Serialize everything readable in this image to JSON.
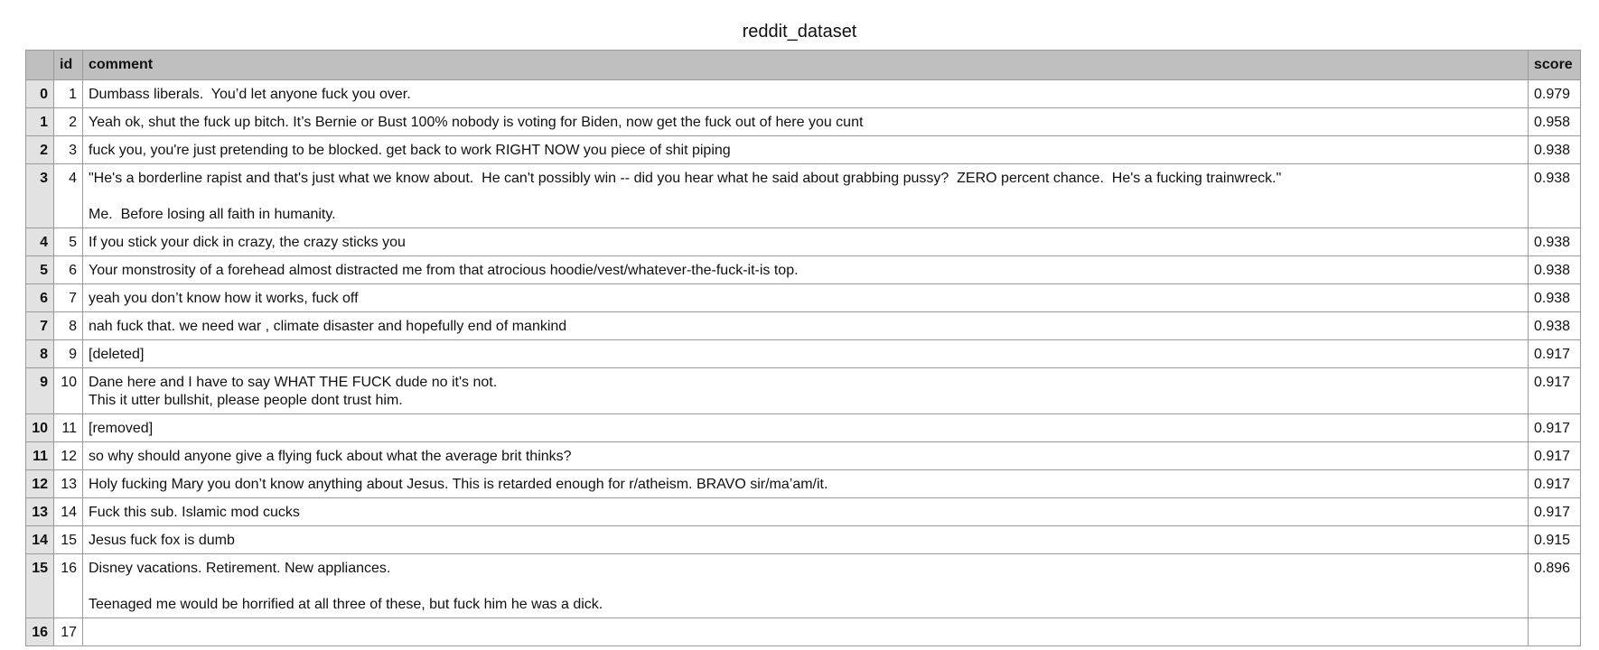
{
  "title": "reddit_dataset",
  "columns": {
    "index": "",
    "id": "id",
    "comment": "comment",
    "score": "score"
  },
  "rows": [
    {
      "index": "0",
      "id": "1",
      "comment": "Dumbass liberals.  You’d let anyone fuck you over.",
      "score": "0.979"
    },
    {
      "index": "1",
      "id": "2",
      "comment": "Yeah ok, shut the fuck up bitch. It’s Bernie or Bust 100% nobody is voting for Biden, now get the fuck out of here you cunt",
      "score": "0.958"
    },
    {
      "index": "2",
      "id": "3",
      "comment": "fuck you, you're just pretending to be blocked. get back to work RIGHT NOW you piece of shit piping",
      "score": "0.938"
    },
    {
      "index": "3",
      "id": "4",
      "comment": "\"He's a borderline rapist and that's just what we know about.  He can't possibly win -- did you hear what he said about grabbing pussy?  ZERO percent chance.  He's a fucking trainwreck.\"\n\nMe.  Before losing all faith in humanity.",
      "score": "0.938"
    },
    {
      "index": "4",
      "id": "5",
      "comment": "If you stick your dick in crazy, the crazy sticks you",
      "score": "0.938"
    },
    {
      "index": "5",
      "id": "6",
      "comment": "Your monstrosity of a forehead almost distracted me from that atrocious hoodie/vest/whatever-the-fuck-it-is top.",
      "score": "0.938"
    },
    {
      "index": "6",
      "id": "7",
      "comment": "yeah you don’t know how it works, fuck off",
      "score": "0.938"
    },
    {
      "index": "7",
      "id": "8",
      "comment": "nah fuck that. we need war , climate disaster and hopefully end of mankind",
      "score": "0.938"
    },
    {
      "index": "8",
      "id": "9",
      "comment": "[deleted]",
      "score": "0.917"
    },
    {
      "index": "9",
      "id": "10",
      "comment": "Dane here and I have to say WHAT THE FUCK dude no it's not.\nThis it utter bullshit, please people dont trust him.\n",
      "score": "0.917"
    },
    {
      "index": "10",
      "id": "11",
      "comment": "[removed]",
      "score": "0.917"
    },
    {
      "index": "11",
      "id": "12",
      "comment": "so why should anyone give a flying fuck about what the average brit thinks?",
      "score": "0.917"
    },
    {
      "index": "12",
      "id": "13",
      "comment": "Holy fucking Mary you don’t know anything about Jesus. This is retarded enough for r/atheism. BRAVO sir/ma’am/it.",
      "score": "0.917"
    },
    {
      "index": "13",
      "id": "14",
      "comment": "Fuck this sub. Islamic mod cucks",
      "score": "0.917"
    },
    {
      "index": "14",
      "id": "15",
      "comment": "Jesus fuck fox is dumb",
      "score": "0.915"
    },
    {
      "index": "15",
      "id": "16",
      "comment": "Disney vacations. Retirement. New appliances.\n\nTeenaged me would be horrified at all three of these, but fuck him he was a dick.",
      "score": "0.896"
    },
    {
      "index": "16",
      "id": "17",
      "comment": "",
      "score": ""
    }
  ]
}
